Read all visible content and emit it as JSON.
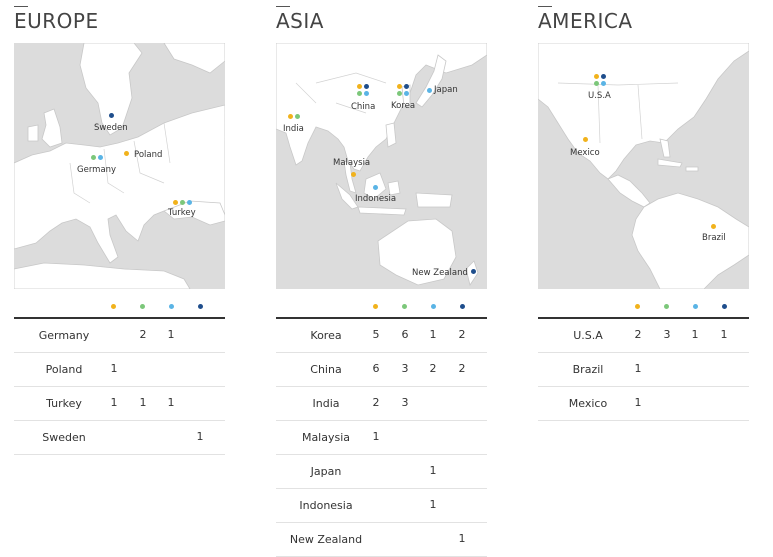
{
  "colors": {
    "c1": "#f1b21c",
    "c2": "#7cc77a",
    "c3": "#5ab4e5",
    "c4": "#1f4e8c"
  },
  "regions": [
    {
      "id": "europe",
      "title": "EUROPE",
      "map_labels": [
        "Sweden",
        "Poland",
        "Germany",
        "Turkey"
      ],
      "rows": [
        {
          "name": "Germany",
          "c1": "",
          "c2": "2",
          "c3": "1",
          "c4": ""
        },
        {
          "name": "Poland",
          "c1": "1",
          "c2": "",
          "c3": "",
          "c4": ""
        },
        {
          "name": "Turkey",
          "c1": "1",
          "c2": "1",
          "c3": "1",
          "c4": ""
        },
        {
          "name": "Sweden",
          "c1": "",
          "c2": "",
          "c3": "",
          "c4": "1"
        }
      ]
    },
    {
      "id": "asia",
      "title": "ASIA",
      "map_labels": [
        "China",
        "Korea",
        "Japan",
        "India",
        "Malaysia",
        "Indonesia",
        "New Zealand"
      ],
      "rows": [
        {
          "name": "Korea",
          "c1": "5",
          "c2": "6",
          "c3": "1",
          "c4": "2"
        },
        {
          "name": "China",
          "c1": "6",
          "c2": "3",
          "c3": "2",
          "c4": "2"
        },
        {
          "name": "India",
          "c1": "2",
          "c2": "3",
          "c3": "",
          "c4": ""
        },
        {
          "name": "Malaysia",
          "c1": "1",
          "c2": "",
          "c3": "",
          "c4": ""
        },
        {
          "name": "Japan",
          "c1": "",
          "c2": "",
          "c3": "1",
          "c4": ""
        },
        {
          "name": "Indonesia",
          "c1": "",
          "c2": "",
          "c3": "1",
          "c4": ""
        },
        {
          "name": "New Zealand",
          "c1": "",
          "c2": "",
          "c3": "",
          "c4": "1"
        }
      ]
    },
    {
      "id": "america",
      "title": "AMERICA",
      "map_labels": [
        "U.S.A",
        "Mexico",
        "Brazil"
      ],
      "rows": [
        {
          "name": "U.S.A",
          "c1": "2",
          "c2": "3",
          "c3": "1",
          "c4": "1"
        },
        {
          "name": "Brazil",
          "c1": "1",
          "c2": "",
          "c3": "",
          "c4": ""
        },
        {
          "name": "Mexico",
          "c1": "1",
          "c2": "",
          "c3": "",
          "c4": ""
        }
      ]
    }
  ]
}
